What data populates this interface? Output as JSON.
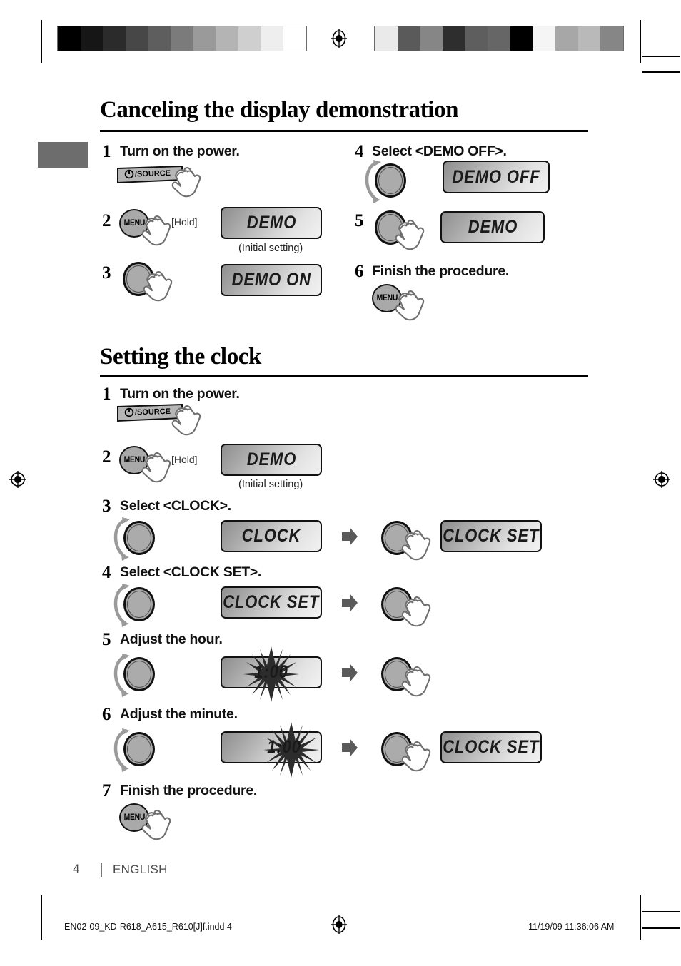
{
  "document": {
    "page_number": "4",
    "language_label": "ENGLISH",
    "footer_file": "EN02-09_KD-R618_A615_R610[J]f.indd   4",
    "footer_timestamp": "11/19/09   11:36:06 AM"
  },
  "sections": [
    {
      "id": "demo",
      "title": "Canceling the display demonstration",
      "steps": [
        {
          "num": "1",
          "text": "Turn on the power."
        },
        {
          "num": "2",
          "text": "",
          "hold_label": "[Hold]",
          "display": "DEMO",
          "display_caption": "(Initial setting)"
        },
        {
          "num": "3",
          "text": "",
          "display": "DEMO ON"
        },
        {
          "num": "4",
          "text": "Select <DEMO OFF>.",
          "display": "DEMO OFF"
        },
        {
          "num": "5",
          "text": "",
          "display": "DEMO"
        },
        {
          "num": "6",
          "text": "Finish the procedure."
        }
      ]
    },
    {
      "id": "clock",
      "title": "Setting the clock",
      "steps": [
        {
          "num": "1",
          "text": "Turn on the power."
        },
        {
          "num": "2",
          "text": "",
          "hold_label": "[Hold]",
          "display": "DEMO",
          "display_caption": "(Initial setting)"
        },
        {
          "num": "3",
          "text": "Select <CLOCK>.",
          "display": "CLOCK",
          "display2": "CLOCK SET"
        },
        {
          "num": "4",
          "text": "Select <CLOCK SET>.",
          "display": "CLOCK SET"
        },
        {
          "num": "5",
          "text": "Adjust the hour.",
          "display": "1:00"
        },
        {
          "num": "6",
          "text": "Adjust the minute.",
          "display": "1:00",
          "display2": "CLOCK SET"
        },
        {
          "num": "7",
          "text": "Finish the procedure."
        }
      ]
    }
  ],
  "controls": {
    "power_button_label": "/SOURCE",
    "power_icon": "power-icon",
    "menu_button_label": "MENU",
    "knob_icon": "rotary-knob-icon",
    "hand_icon": "pointing-hand-icon",
    "arrow_icon": "right-arrow-icon",
    "burst_icon": "blinking-starburst-icon"
  },
  "print_marks": {
    "registration_icon": "registration-target-icon",
    "calbar_left": [
      "#000000",
      "#161616",
      "#2b2b2b",
      "#474747",
      "#5e5e5e",
      "#7b7b7b",
      "#9a9a9a",
      "#b4b4b4",
      "#cfcfcf",
      "#eeeeee",
      "#ffffff"
    ],
    "calbar_right": [
      "#eaeaea",
      "#5a5a5a",
      "#868686",
      "#2e2e2e",
      "#5e5e5e",
      "#666666",
      "#000000",
      "#f5f5f5",
      "#a7a7a7",
      "#b9b9b9",
      "#868686"
    ]
  },
  "colors": {
    "rule": "#000000",
    "tab": "#6d6d6d",
    "arrow": "#5a5a5a",
    "lcd_border": "#111111"
  }
}
